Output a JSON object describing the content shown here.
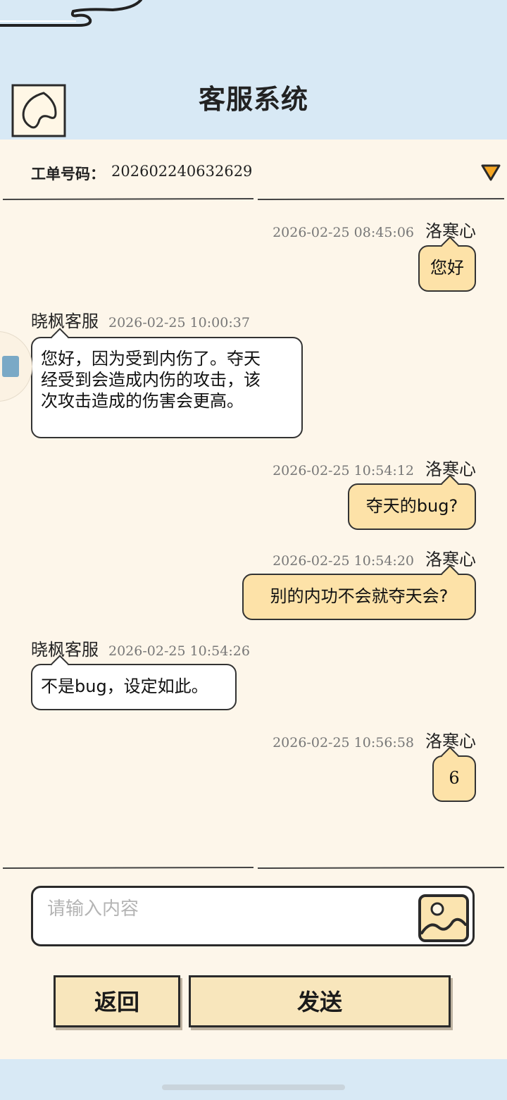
{
  "header": {
    "title": "客服系统",
    "back_icon": "back-chevron-icon"
  },
  "ticket": {
    "label": "工单号码：",
    "number": "202602240632629",
    "toggle_icon": "triangle-down-icon"
  },
  "messages": [
    {
      "sender": "洛寒心",
      "time": "2026-02-25 08:45:06",
      "text": "您好"
    },
    {
      "sender": "晓枫客服",
      "time": "2026-02-25 10:00:37",
      "text": "您好，因为受到内伤了。夺天经受到会造成内伤的攻击，该次攻击造成的伤害会更高。"
    },
    {
      "sender": "洛寒心",
      "time": "2026-02-25 10:54:12",
      "text": "夺天的bug?"
    },
    {
      "sender": "洛寒心",
      "time": "2026-02-25 10:54:20",
      "text": "别的内功不会就夺天会?"
    },
    {
      "sender": "晓枫客服",
      "time": "2026-02-25 10:54:26",
      "text": "不是bug，设定如此。"
    },
    {
      "sender": "洛寒心",
      "time": "2026-02-25 10:56:58",
      "text": "6"
    }
  ],
  "composer": {
    "placeholder": "请输入内容",
    "value": "",
    "image_icon": "image-upload-icon"
  },
  "buttons": {
    "back_label": "返回",
    "send_label": "发送"
  },
  "colors": {
    "header_bg": "#d8e9f5",
    "page_bg": "#fdf6ea",
    "user_bubble": "#fde2a8",
    "agent_bubble": "#ffffff",
    "button_bg": "#f8e6bc",
    "accent_triangle": "#f5a623"
  }
}
